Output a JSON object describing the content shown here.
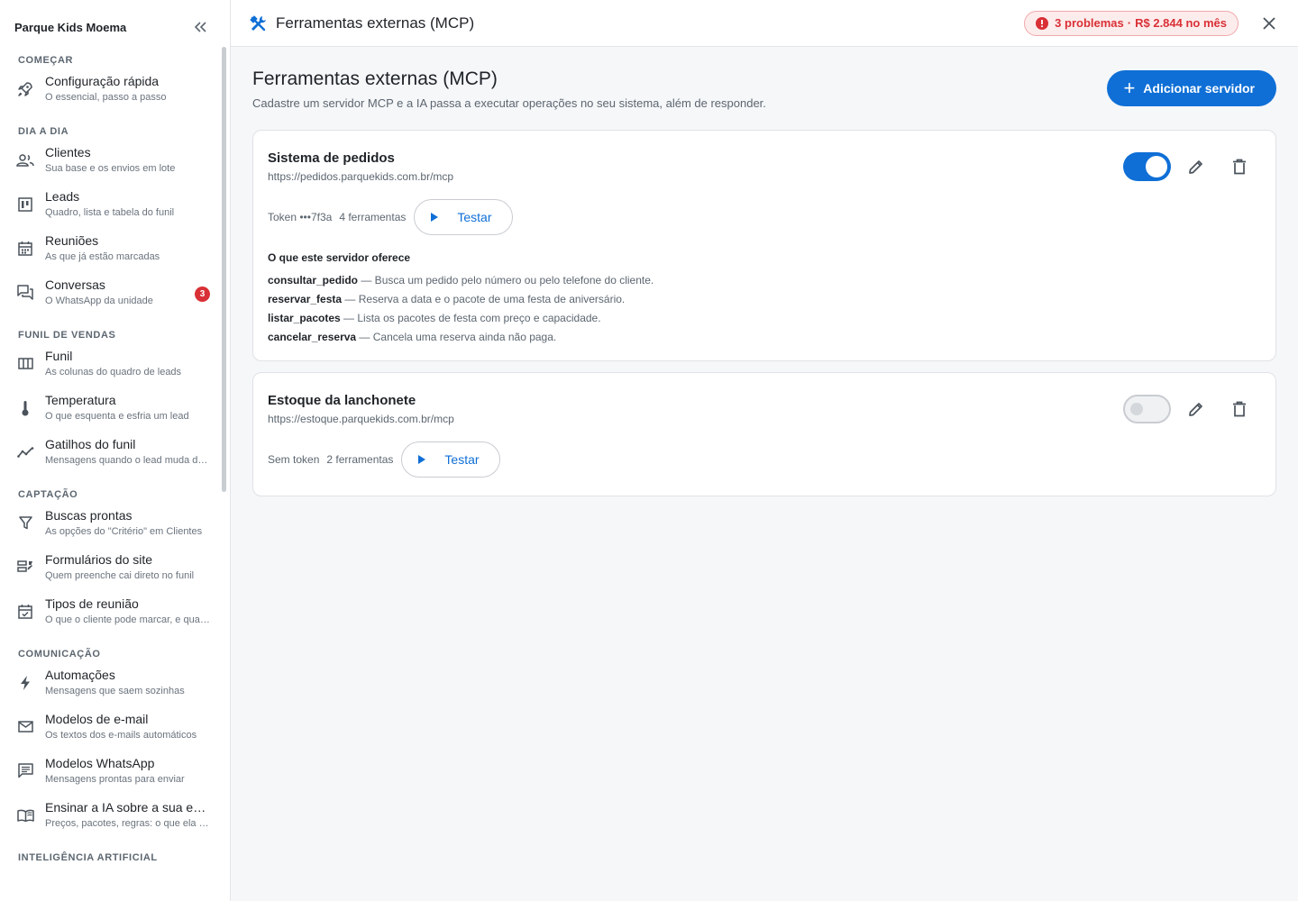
{
  "sidebar": {
    "title": "Parque Kids Moema",
    "sections": [
      {
        "label": "COMEÇAR",
        "items": [
          {
            "label": "Configuração rápida",
            "sub": "O essencial, passo a passo",
            "icon": "rocket-icon"
          }
        ]
      },
      {
        "label": "DIA A DIA",
        "items": [
          {
            "label": "Clientes",
            "sub": "Sua base e os envios em lote",
            "icon": "people-icon"
          },
          {
            "label": "Leads",
            "sub": "Quadro, lista e tabela do funil",
            "icon": "kanban-icon"
          },
          {
            "label": "Reuniões",
            "sub": "As que já estão marcadas",
            "icon": "calendar-icon"
          },
          {
            "label": "Conversas",
            "sub": "O WhatsApp da unidade",
            "icon": "chat-icon",
            "badge": "3"
          }
        ]
      },
      {
        "label": "FUNIL DE VENDAS",
        "items": [
          {
            "label": "Funil",
            "sub": "As colunas do quadro de leads",
            "icon": "columns-icon"
          },
          {
            "label": "Temperatura",
            "sub": "O que esquenta e esfria um lead",
            "icon": "thermometer-icon"
          },
          {
            "label": "Gatilhos do funil",
            "sub": "Mensagens quando o lead muda de etapa",
            "icon": "trend-icon"
          }
        ]
      },
      {
        "label": "CAPTAÇÃO",
        "items": [
          {
            "label": "Buscas prontas",
            "sub": "As opções do \"Critério\" em Clientes",
            "icon": "filter-icon"
          },
          {
            "label": "Formulários do site",
            "sub": "Quem preenche cai direto no funil",
            "icon": "form-icon"
          },
          {
            "label": "Tipos de reunião",
            "sub": "O que o cliente pode marcar, e quando",
            "icon": "event-check-icon"
          }
        ]
      },
      {
        "label": "COMUNICAÇÃO",
        "items": [
          {
            "label": "Automações",
            "sub": "Mensagens que saem sozinhas",
            "icon": "bolt-icon"
          },
          {
            "label": "Modelos de e-mail",
            "sub": "Os textos dos e-mails automáticos",
            "icon": "mail-icon"
          },
          {
            "label": "Modelos WhatsApp",
            "sub": "Mensagens prontas para enviar",
            "icon": "message-icon"
          },
          {
            "label": "Ensinar a IA sobre a sua empresa",
            "sub": "Preços, pacotes, regras: o que ela precisa saber",
            "icon": "book-icon"
          }
        ]
      },
      {
        "label": "INTELIGÊNCIA ARTIFICIAL",
        "items": []
      }
    ]
  },
  "topbar": {
    "title": "Ferramentas externas (MCP)",
    "problems_count": "3 problemas",
    "problems_cost": "R$ 2.844 no mês"
  },
  "main": {
    "title": "Ferramentas externas (MCP)",
    "description": "Cadastre um servidor MCP e a IA passa a executar operações no seu sistema, além de responder.",
    "add_label": "Adicionar servidor"
  },
  "servers": [
    {
      "name": "Sistema de pedidos",
      "url": "https://pedidos.parquekids.com.br/mcp",
      "enabled": true,
      "token": "Token •••7f3a",
      "tools_count": "4 ferramentas",
      "test_label": "Testar",
      "offers_title": "O que este servidor oferece",
      "tools": [
        {
          "name": "consultar_pedido",
          "desc": " — Busca um pedido pelo número ou pelo telefone do cliente."
        },
        {
          "name": "reservar_festa",
          "desc": " — Reserva a data e o pacote de uma festa de aniversário."
        },
        {
          "name": "listar_pacotes",
          "desc": " — Lista os pacotes de festa com preço e capacidade."
        },
        {
          "name": "cancelar_reserva",
          "desc": " — Cancela uma reserva ainda não paga."
        }
      ]
    },
    {
      "name": "Estoque da lanchonete",
      "url": "https://estoque.parquekids.com.br/mcp",
      "enabled": false,
      "token": "Sem token",
      "tools_count": "2 ferramentas",
      "test_label": "Testar"
    }
  ],
  "colors": {
    "accent": "#0f6fd6",
    "danger": "#d93036"
  }
}
